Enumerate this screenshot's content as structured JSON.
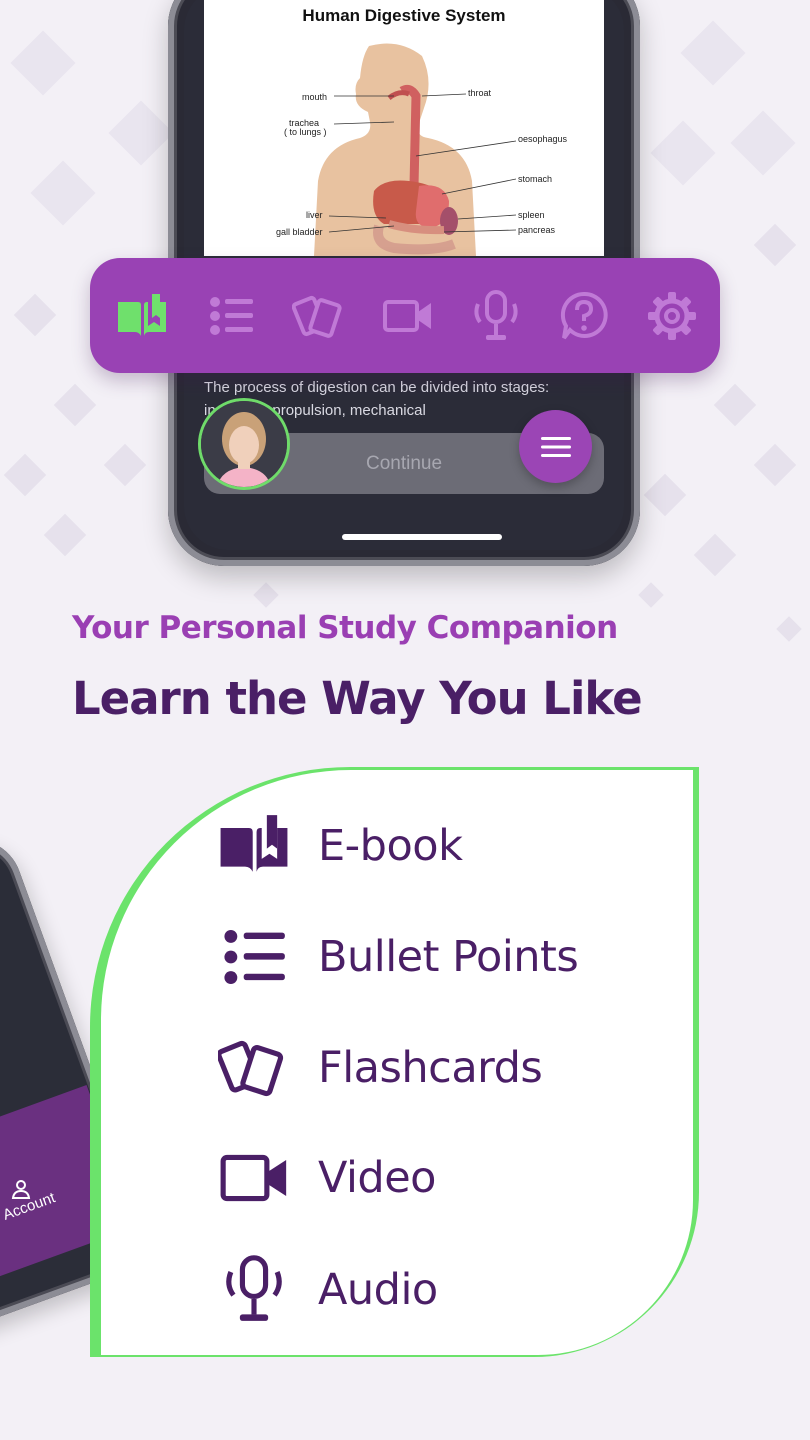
{
  "phone": {
    "diagram_title": "Human Digestive System",
    "organ_labels": {
      "mouth": "mouth",
      "throat": "throat",
      "trachea": "trachea",
      "trachea_note": "( to lungs )",
      "oesophagus": "oesophagus",
      "stomach": "stomach",
      "liver": "liver",
      "spleen": "spleen",
      "gall_bladder": "gall bladder",
      "pancreas": "pancreas"
    },
    "lesson_text": "The process of digestion can be divided into stages: ingestion, propulsion, mechanical",
    "continue_label": "Continue"
  },
  "toolbar": {
    "items": [
      {
        "icon": "ebook-icon",
        "active": true
      },
      {
        "icon": "bullet-list-icon",
        "active": false
      },
      {
        "icon": "flashcards-icon",
        "active": false
      },
      {
        "icon": "video-icon",
        "active": false
      },
      {
        "icon": "microphone-icon",
        "active": false
      },
      {
        "icon": "help-icon",
        "active": false
      },
      {
        "icon": "settings-icon",
        "active": false
      }
    ],
    "active_color": "#6fe06c",
    "inactive_color": "#c07ad6"
  },
  "tagline": "Your Personal Study Companion",
  "headline": "Learn the Way You Like",
  "second_phone": {
    "account_label": "Account"
  },
  "features": [
    {
      "icon": "ebook-icon",
      "label": "E-book"
    },
    {
      "icon": "bullet-list-icon",
      "label": "Bullet Points"
    },
    {
      "icon": "flashcards-icon",
      "label": "Flashcards"
    },
    {
      "icon": "video-icon",
      "label": "Video"
    },
    {
      "icon": "microphone-icon",
      "label": "Audio"
    }
  ],
  "colors": {
    "purple_brand": "#9942b4",
    "deep_purple": "#4a1f66",
    "green_accent": "#6be36b"
  }
}
